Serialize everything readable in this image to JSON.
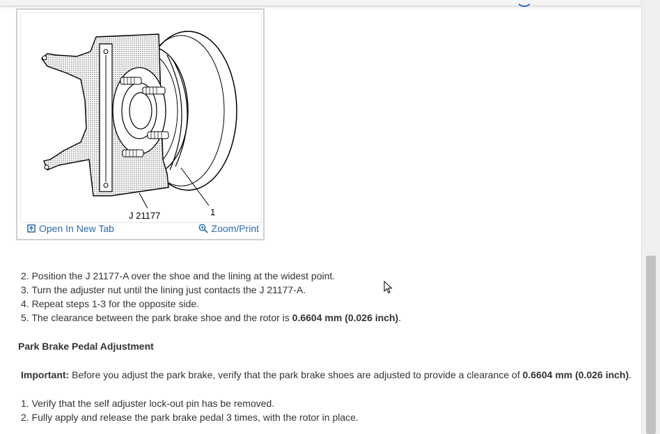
{
  "figure": {
    "callouts": {
      "tool": "J 21177",
      "part": "1"
    },
    "open_tab_label": "Open In New Tab",
    "zoom_label": "Zoom/Print",
    "open_tab_icon": "open-in-new-tab-icon",
    "zoom_icon": "magnifier-icon"
  },
  "steps_a": [
    {
      "num": "2.",
      "text": "Position the J 21177-A over the shoe and the lining at the widest point."
    },
    {
      "num": "3.",
      "text": "Turn the adjuster nut until the lining just contacts the J 21177-A."
    },
    {
      "num": "4.",
      "text": "Repeat steps 1-3 for the opposite side."
    },
    {
      "num": "5.",
      "text": "The clearance between the park brake shoe and the rotor is ",
      "bold": "0.6604 mm (0.026 inch)",
      "after": "."
    }
  ],
  "section_title": "Park Brake Pedal Adjustment",
  "important": {
    "label": "Important:",
    "text": " Before you adjust the park brake, verify that the park brake shoes are adjusted to provide a clearance of ",
    "bold": "0.6604 mm (0.026 inch)",
    "after": "."
  },
  "steps_b": [
    {
      "num": "1.",
      "text": "Verify that the self adjuster lock-out pin has be removed."
    },
    {
      "num": "2.",
      "text": "Fully apply and release the park brake pedal 3 times, with the rotor in place."
    }
  ],
  "colors": {
    "link": "#2a6aa8",
    "text": "#333333",
    "border": "#cfcfcf"
  }
}
